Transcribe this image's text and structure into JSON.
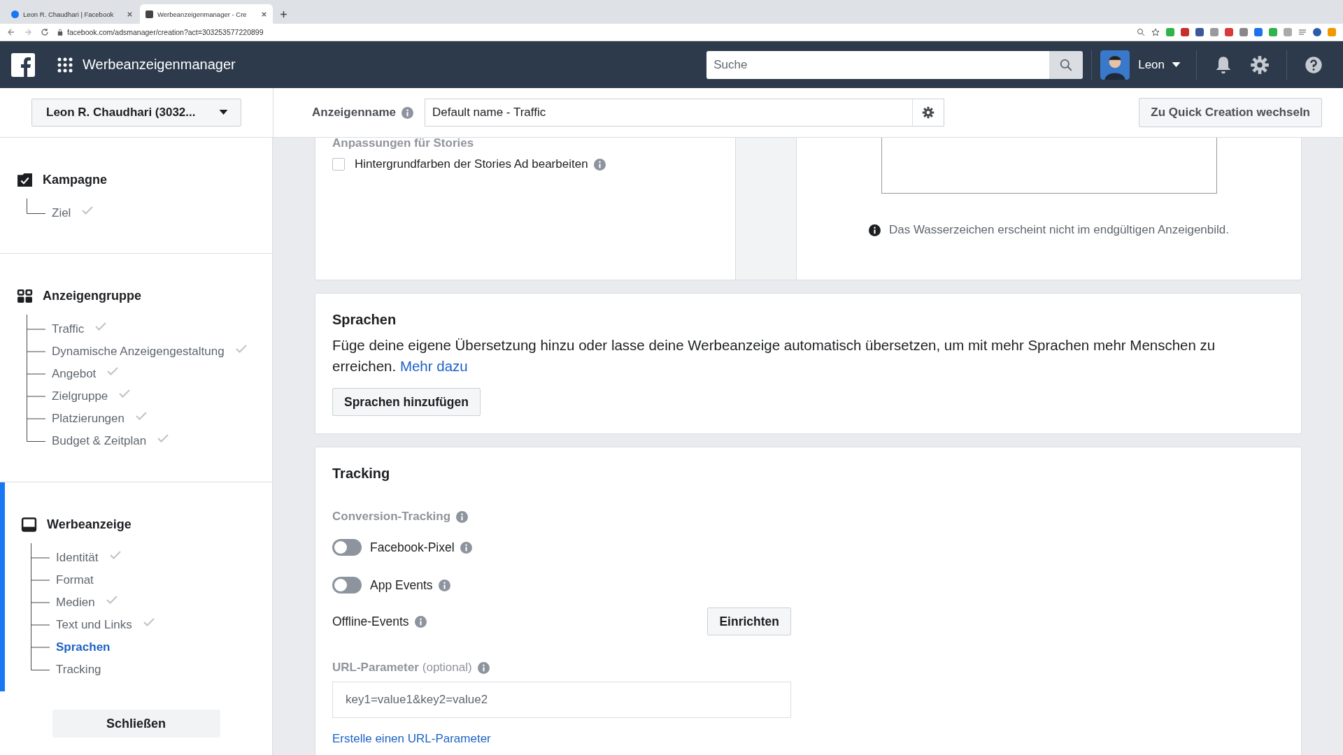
{
  "browser": {
    "tabs": [
      {
        "title": "Leon R. Chaudhari | Facebook",
        "selected": false
      },
      {
        "title": "Werbeanzeigenmanager - Cre",
        "selected": true
      }
    ],
    "url": "facebook.com/adsmanager/creation?act=303253577220899"
  },
  "header": {
    "title": "Werbeanzeigenmanager",
    "search_placeholder": "Suche",
    "user": "Leon"
  },
  "subheader": {
    "account": "Leon R. Chaudhari (3032...",
    "name_label": "Anzeigenname",
    "name_value": "Default name - Traffic",
    "switch_button": "Zu Quick Creation wechseln"
  },
  "sidebar": {
    "sections": [
      {
        "kind": "campaign",
        "title": "Kampagne",
        "selected": false,
        "children": [
          {
            "label": "Ziel",
            "done": true,
            "selected": false
          }
        ]
      },
      {
        "kind": "adset",
        "title": "Anzeigengruppe",
        "selected": false,
        "children": [
          {
            "label": "Traffic",
            "done": true,
            "selected": false
          },
          {
            "label": "Dynamische Anzeigengestaltung",
            "done": true,
            "selected": false
          },
          {
            "label": "Angebot",
            "done": true,
            "selected": false
          },
          {
            "label": "Zielgruppe",
            "done": true,
            "selected": false
          },
          {
            "label": "Platzierungen",
            "done": true,
            "selected": false
          },
          {
            "label": "Budget & Zeitplan",
            "done": true,
            "selected": false
          }
        ]
      },
      {
        "kind": "ad",
        "title": "Werbeanzeige",
        "selected": true,
        "children": [
          {
            "label": "Identität",
            "done": true,
            "selected": false
          },
          {
            "label": "Format",
            "done": false,
            "selected": false
          },
          {
            "label": "Medien",
            "done": true,
            "selected": false
          },
          {
            "label": "Text und Links",
            "done": true,
            "selected": false
          },
          {
            "label": "Sprachen",
            "done": false,
            "selected": true
          },
          {
            "label": "Tracking",
            "done": false,
            "selected": false
          }
        ]
      }
    ],
    "close_button": "Schließen"
  },
  "stories": {
    "heading": "Anpassungen für Stories",
    "checkbox": {
      "label": "Hintergrundfarben der Stories Ad bearbeiten",
      "checked": false
    },
    "note": "Das Wasserzeichen erscheint nicht im endgültigen Anzeigenbild."
  },
  "languages": {
    "heading": "Sprachen",
    "text": "Füge deine eigene Übersetzung hinzu oder lasse deine Werbeanzeige automatisch übersetzen, um mit mehr Sprachen mehr Menschen zu erreichen.",
    "link": "Mehr dazu",
    "button": "Sprachen hinzufügen"
  },
  "tracking": {
    "heading": "Tracking",
    "conversion_label": "Conversion-Tracking",
    "toggles": [
      {
        "label": "Facebook-Pixel",
        "on": false
      },
      {
        "label": "App Events",
        "on": false
      }
    ],
    "offline": {
      "label": "Offline-Events",
      "button": "Einrichten"
    },
    "url_label": "URL-Parameter",
    "url_optional": "(optional)",
    "url_placeholder": "key1=value1&key2=value2",
    "url_link": "Erstelle einen URL-Parameter"
  }
}
